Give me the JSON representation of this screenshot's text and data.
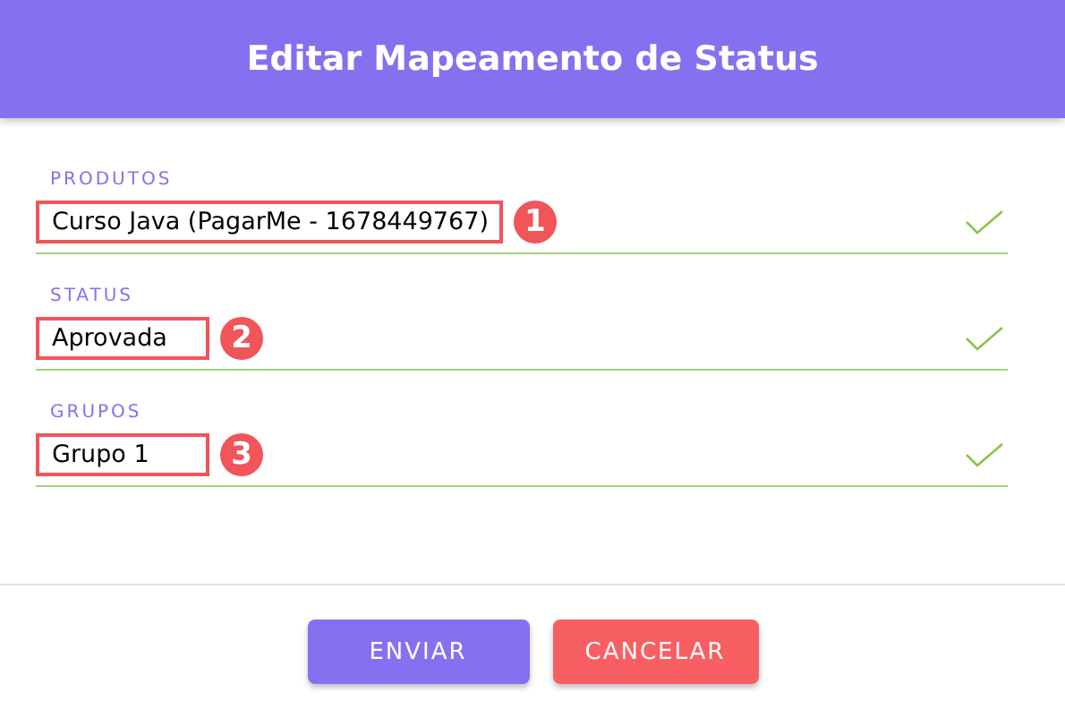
{
  "dialog": {
    "title": "Editar Mapeamento de Status"
  },
  "fields": [
    {
      "label": "PRODUTOS",
      "value": "Curso Java (PagarMe - 1678449767)",
      "valid": true,
      "highlighted": true,
      "callout": "1"
    },
    {
      "label": "STATUS",
      "value": "Aprovada",
      "valid": true,
      "highlighted": true,
      "callout": "2"
    },
    {
      "label": "GRUPOS",
      "value": "Grupo 1",
      "valid": true,
      "highlighted": true,
      "callout": "3"
    }
  ],
  "buttons": [
    {
      "label": "ENVIAR",
      "kind": "primary"
    },
    {
      "label": "CANCELAR",
      "kind": "danger"
    }
  ]
}
